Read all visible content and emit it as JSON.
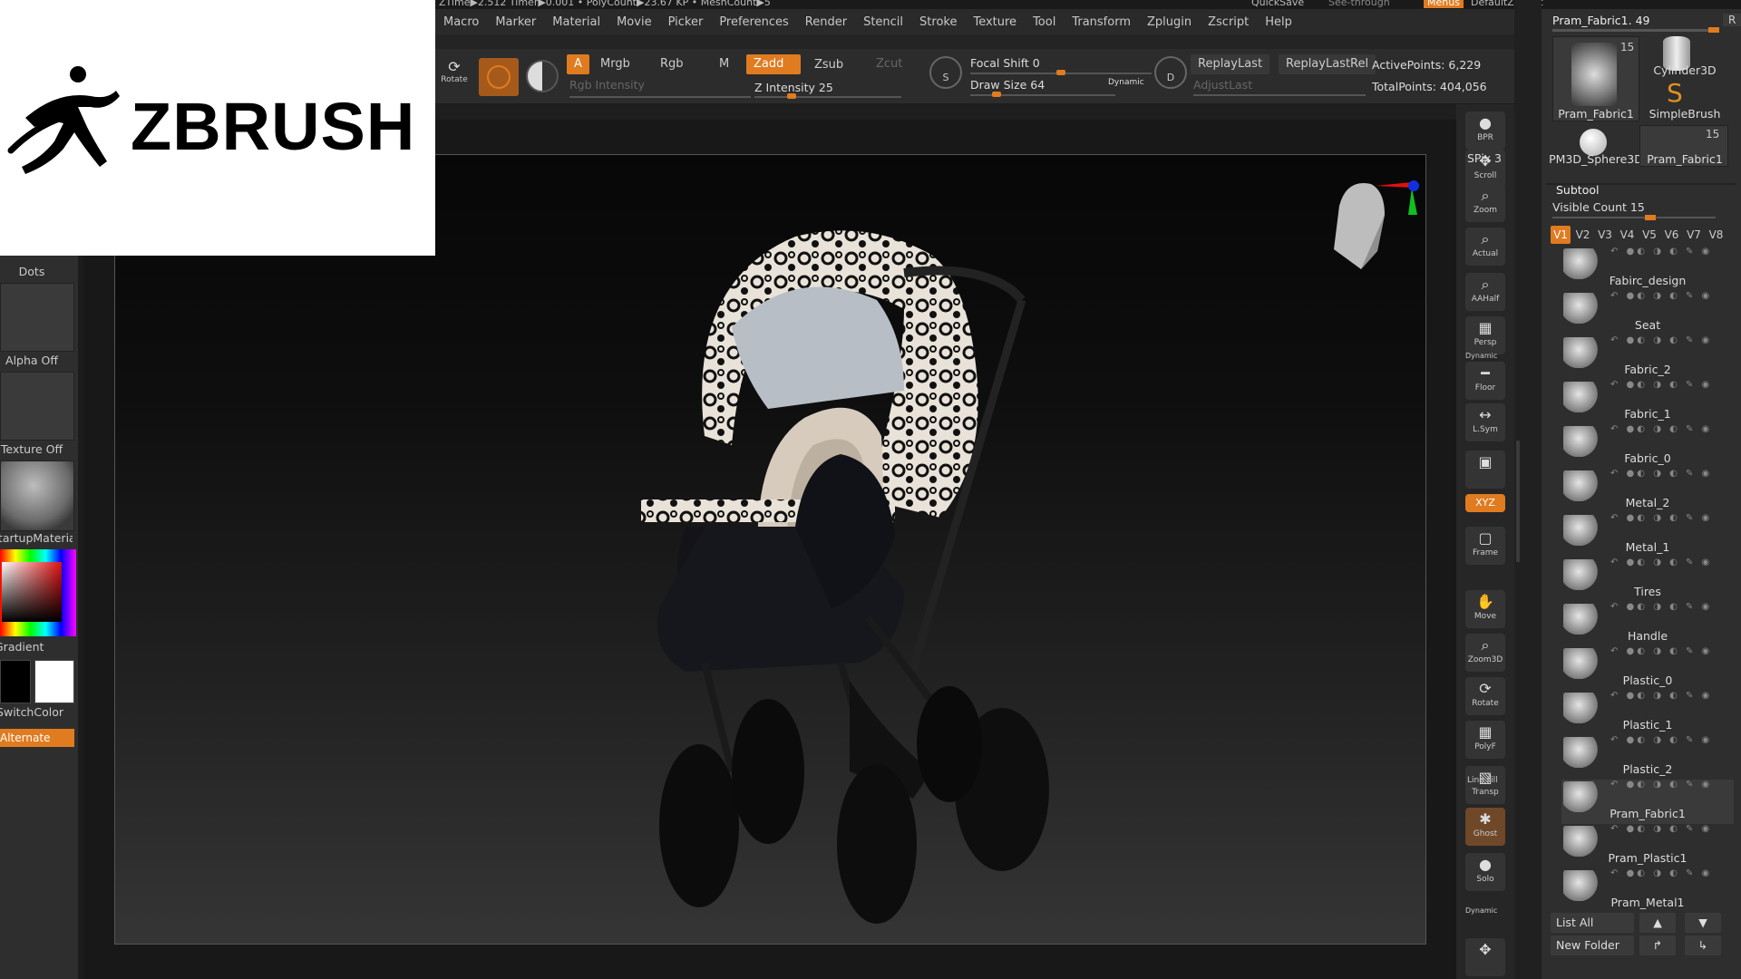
{
  "topstrip": {
    "left_text": "ZTime▶2.512 Timer▶0.001 • PolyCount▶23.67 KP • MeshCount▶5",
    "quicksave": "QuickSave",
    "see_through": "See-through",
    "menus": "Menus",
    "default_script": "DefaultZScript"
  },
  "menus": [
    "Macro",
    "Marker",
    "Material",
    "Movie",
    "Picker",
    "Preferences",
    "Render",
    "Stencil",
    "Stroke",
    "Texture",
    "Tool",
    "Transform",
    "Zplugin",
    "Zscript",
    "Help"
  ],
  "toolbar": {
    "rotate": "Rotate",
    "a": "A",
    "mrgb": "Mrgb",
    "rgb": "Rgb",
    "m": "M",
    "zadd": "Zadd",
    "zsub": "Zsub",
    "zcut": "Zcut",
    "rgb_intensity": "Rgb Intensity",
    "z_intensity": "Z Intensity 25",
    "focal_shift": "Focal Shift 0",
    "draw_size": "Draw Size 64",
    "dynamic": "Dynamic",
    "s": "S",
    "d": "D",
    "replay_last": "ReplayLast",
    "replay_last_rel": "ReplayLastRel",
    "adjust_last": "AdjustLast",
    "active_points": "ActivePoints: 6,229",
    "total_points": "TotalPoints: 404,056",
    "z_intensity_level": 0.25,
    "focal_shift_level": 0.5,
    "draw_size_level": 0.15
  },
  "logo": {
    "text": "ZBRUSH"
  },
  "left": {
    "dots": "Dots",
    "alpha": "Alpha Off",
    "texture": "Texture Off",
    "material": "StartupMaterial",
    "gradient": "Gradient",
    "switch": "SwitchColor",
    "alternate": "Alternate"
  },
  "righttools": [
    {
      "name": "bpr",
      "glyph": "●",
      "label": "BPR"
    },
    {
      "name": "scroll",
      "glyph": "✥",
      "label": "Scroll"
    },
    {
      "name": "zoom",
      "glyph": "⌕",
      "label": "Zoom"
    },
    {
      "name": "actual",
      "glyph": "⌕",
      "label": "Actual"
    },
    {
      "name": "aahalf",
      "glyph": "⌕",
      "label": "AAHalf"
    },
    {
      "name": "persp",
      "glyph": "▦",
      "label": "Persp"
    },
    {
      "name": "floor",
      "glyph": "━",
      "label": "Floor"
    },
    {
      "name": "lsym",
      "glyph": "↔",
      "label": "L.Sym"
    },
    {
      "name": "lock",
      "glyph": "▣",
      "label": ""
    },
    {
      "name": "xyz",
      "glyph": "⟲",
      "label": "XYZ"
    },
    {
      "name": "frame",
      "glyph": "▢",
      "label": "Frame"
    },
    {
      "name": "move",
      "glyph": "✋",
      "label": "Move"
    },
    {
      "name": "zoom3d",
      "glyph": "⌕",
      "label": "Zoom3D"
    },
    {
      "name": "rotate",
      "glyph": "⟳",
      "label": "Rotate"
    },
    {
      "name": "polyf",
      "glyph": "▦",
      "label": "PolyF"
    },
    {
      "name": "transp",
      "glyph": "▧",
      "label": "Transp"
    },
    {
      "name": "ghost",
      "glyph": "✱",
      "label": "Ghost"
    },
    {
      "name": "solo",
      "glyph": "●",
      "label": "Solo"
    },
    {
      "name": "xpose",
      "glyph": "✥",
      "label": ""
    }
  ],
  "righttools_extra": {
    "spix": "SPix 3",
    "dynamic": "Dynamic",
    "line_fill": "Line Fill",
    "dynamic2": "Dynamic"
  },
  "tool": {
    "current": "Pram_Fabric1. 49",
    "r": "R",
    "thumbs": [
      {
        "label": "Pram_Fabric1",
        "count": "15"
      },
      {
        "label": "Cylinder3D",
        "count": ""
      },
      {
        "label": "SimpleBrush",
        "count": ""
      },
      {
        "label": "PM3D_Sphere3D",
        "count": ""
      },
      {
        "label": "Pram_Fabric1",
        "count": "15"
      }
    ]
  },
  "subtool": {
    "title": "Subtool",
    "visible_count": "Visible Count 15",
    "visible_level": 0.6,
    "versions": [
      "V1",
      "V2",
      "V3",
      "V4",
      "V5",
      "V6",
      "V7",
      "V8"
    ],
    "items": [
      "Fabirc_design",
      "Seat",
      "Fabric_2",
      "Fabric_1",
      "Fabric_0",
      "Metal_2",
      "Metal_1",
      "Tires",
      "Handle",
      "Plastic_0",
      "Plastic_1",
      "Plastic_2",
      "Pram_Fabric1",
      "Pram_Plastic1",
      "Pram_Metal1"
    ],
    "list_all": "List All",
    "new_folder": "New Folder"
  },
  "colors": {
    "accent": "#e07b20",
    "panel": "#2e2e2e"
  }
}
